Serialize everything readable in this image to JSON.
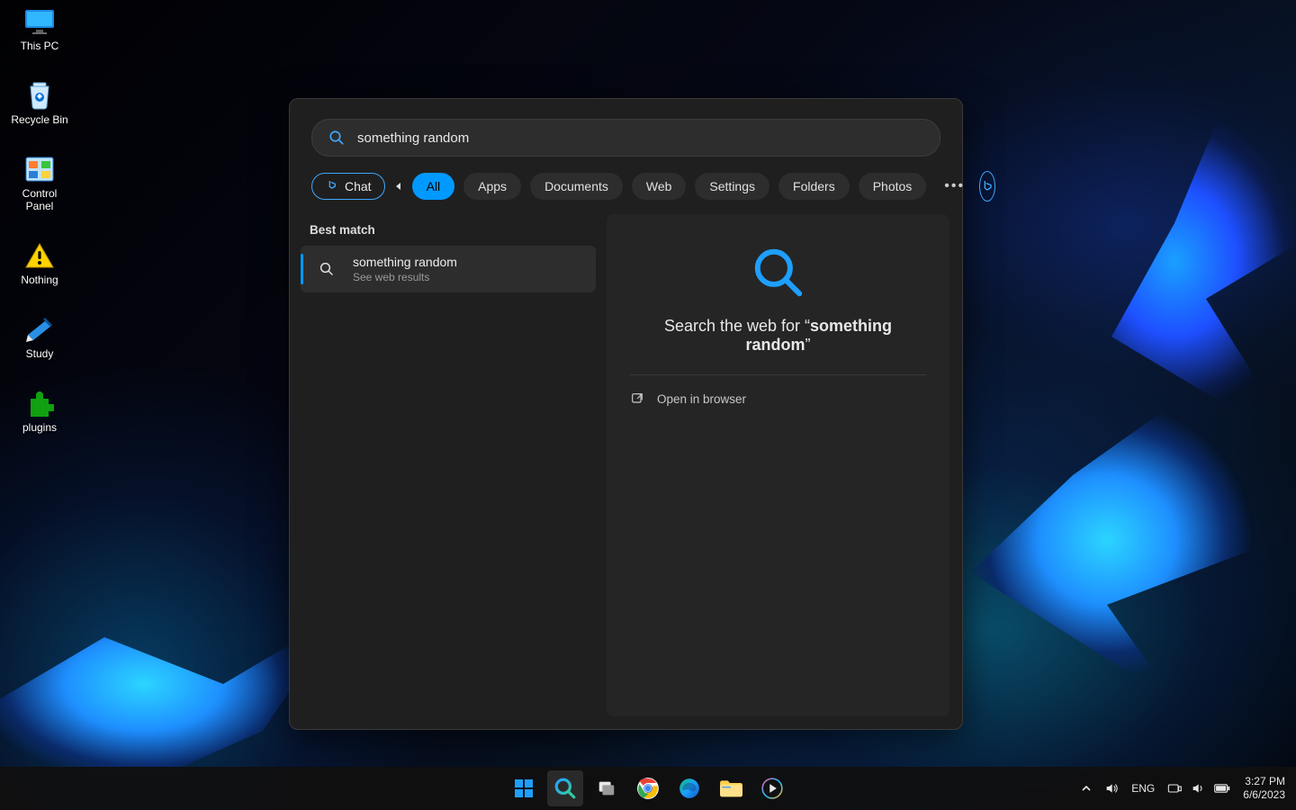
{
  "desktop": {
    "icons": [
      {
        "label": "This PC",
        "glyph": "pc"
      },
      {
        "label": "Nothing",
        "glyph": "warn"
      },
      {
        "label": "plugins",
        "glyph": "puzzle"
      },
      {
        "label": "Recycle Bin",
        "glyph": "bin"
      },
      {
        "label": "Study",
        "glyph": "book"
      },
      {
        "label": "Control Panel",
        "glyph": "panel"
      }
    ]
  },
  "search": {
    "query": "something random",
    "chat_label": "Chat",
    "filters": [
      "All",
      "Apps",
      "Documents",
      "Web",
      "Settings",
      "Folders",
      "Photos"
    ],
    "active_filter": "All",
    "best_match_label": "Best match",
    "result": {
      "title": "something random",
      "subtitle": "See web results"
    },
    "preview": {
      "prefix": "Search the web for “",
      "term": "something random",
      "suffix": "”",
      "open_label": "Open in browser"
    }
  },
  "taskbar": {
    "lang": "ENG",
    "time": "3:27 PM",
    "date": "6/6/2023"
  }
}
